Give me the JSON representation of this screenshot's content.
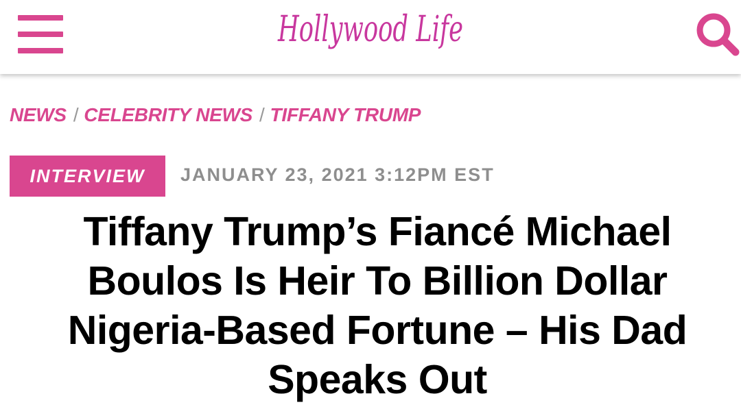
{
  "header": {
    "logo_text": "Hollywood Life",
    "menu_icon": "hamburger-menu-icon",
    "search_icon": "search-icon",
    "brand_color": "#d9468f"
  },
  "breadcrumb": {
    "items": [
      "NEWS",
      "CELEBRITY NEWS",
      "TIFFANY TRUMP"
    ],
    "separator": "/"
  },
  "article": {
    "category_badge": "INTERVIEW",
    "date": "JANUARY 23, 2021 3:12PM EST",
    "headline": "Tiffany Trump’s Fiancé Michael Boulos Is Heir To Billion Dollar Nigeria-Based Fortune – His Dad Speaks Out"
  }
}
